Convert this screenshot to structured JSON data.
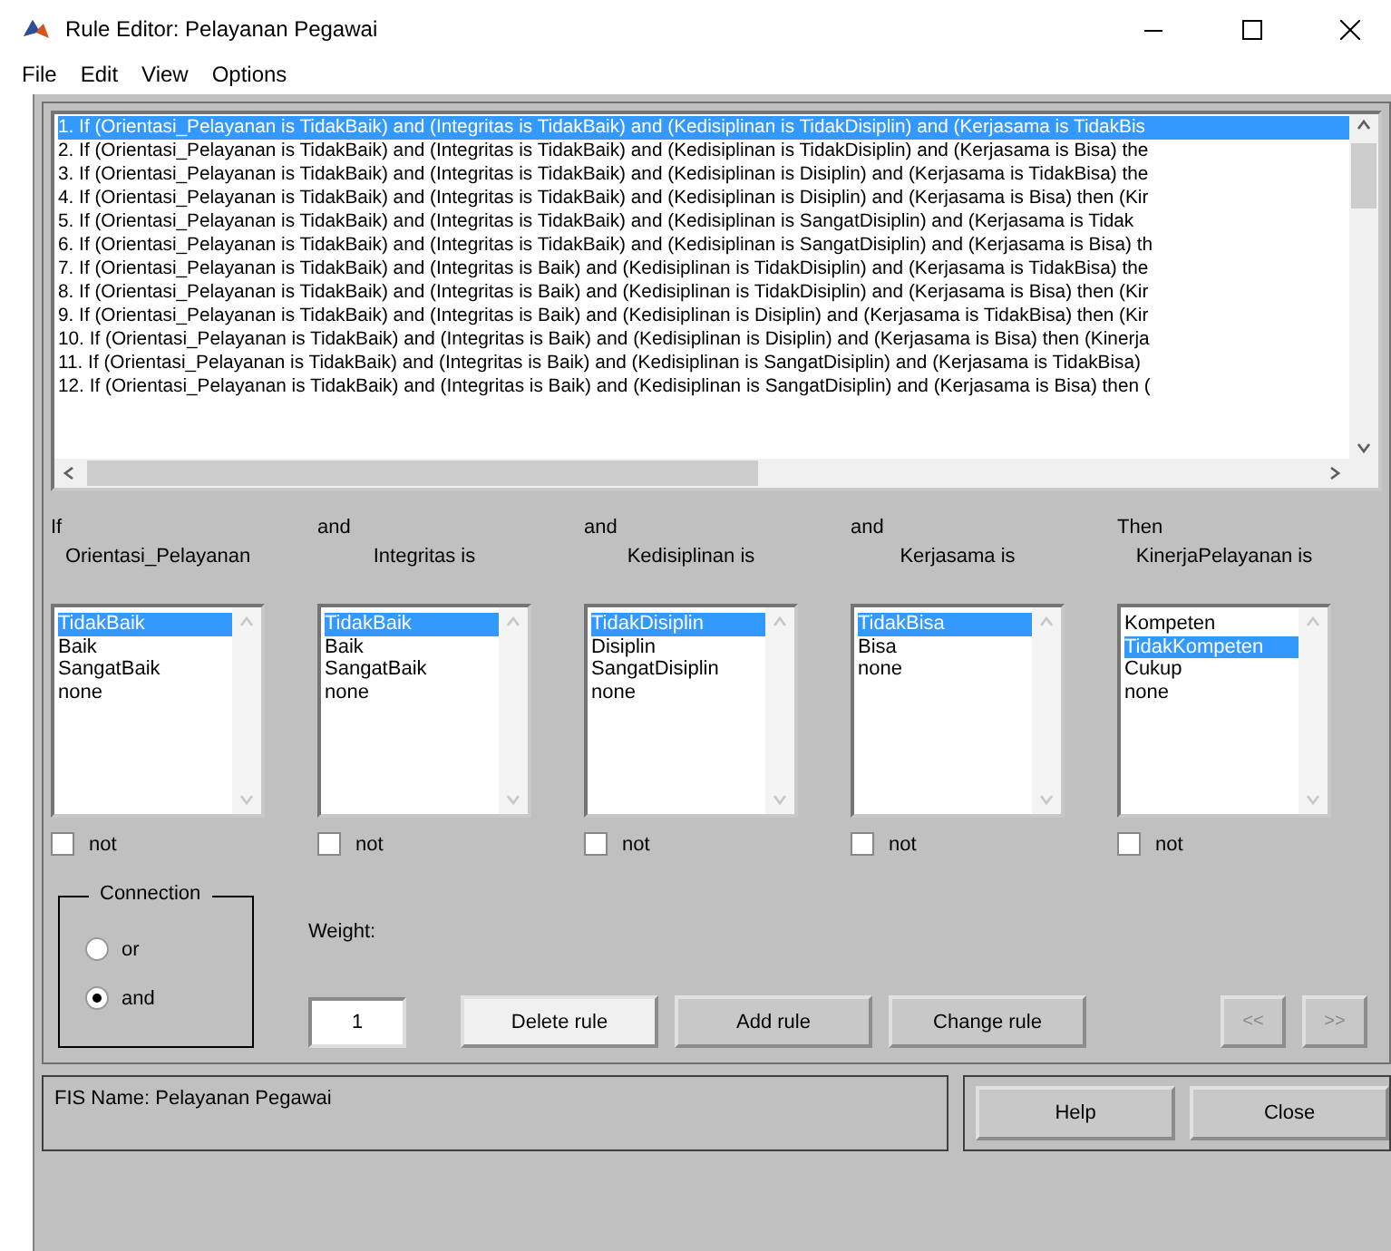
{
  "window": {
    "title": "Rule Editor: Pelayanan Pegawai"
  },
  "menu": [
    "File",
    "Edit",
    "View",
    "Options"
  ],
  "rules": [
    {
      "text": "1. If (Orientasi_Pelayanan is TidakBaik) and (Integritas is TidakBaik) and (Kedisiplinan is TidakDisiplin) and (Kerjasama is TidakBis",
      "selected": true
    },
    {
      "text": "2. If (Orientasi_Pelayanan is TidakBaik) and (Integritas is TidakBaik) and (Kedisiplinan is TidakDisiplin) and (Kerjasama is Bisa) the",
      "selected": false
    },
    {
      "text": "3. If (Orientasi_Pelayanan is TidakBaik) and (Integritas is TidakBaik) and (Kedisiplinan is Disiplin) and (Kerjasama is TidakBisa) the",
      "selected": false
    },
    {
      "text": "4. If (Orientasi_Pelayanan is TidakBaik) and (Integritas is TidakBaik) and (Kedisiplinan is Disiplin) and (Kerjasama is Bisa) then (Kir",
      "selected": false
    },
    {
      "text": "5. If (Orientasi_Pelayanan is TidakBaik) and (Integritas is TidakBaik) and (Kedisiplinan is SangatDisiplin) and (Kerjasama is Tidak",
      "selected": false
    },
    {
      "text": "6. If (Orientasi_Pelayanan is TidakBaik) and (Integritas is TidakBaik) and (Kedisiplinan is SangatDisiplin) and (Kerjasama is Bisa) th",
      "selected": false
    },
    {
      "text": "7. If (Orientasi_Pelayanan is TidakBaik) and (Integritas is Baik) and (Kedisiplinan is TidakDisiplin) and (Kerjasama is TidakBisa) the",
      "selected": false
    },
    {
      "text": "8. If (Orientasi_Pelayanan is TidakBaik) and (Integritas is Baik) and (Kedisiplinan is TidakDisiplin) and (Kerjasama is Bisa) then (Kir",
      "selected": false
    },
    {
      "text": "9. If (Orientasi_Pelayanan is TidakBaik) and (Integritas is Baik) and (Kedisiplinan is Disiplin) and (Kerjasama is TidakBisa) then (Kir",
      "selected": false
    },
    {
      "text": "10. If (Orientasi_Pelayanan is TidakBaik) and (Integritas is Baik) and (Kedisiplinan is Disiplin) and (Kerjasama is Bisa) then (Kinerja",
      "selected": false
    },
    {
      "text": "11. If (Orientasi_Pelayanan is TidakBaik) and (Integritas is Baik) and (Kedisiplinan is SangatDisiplin) and (Kerjasama is TidakBisa)",
      "selected": false
    },
    {
      "text": "12. If (Orientasi_Pelayanan is TidakBaik) and (Integritas is Baik) and (Kedisiplinan is SangatDisiplin) and (Kerjasama is Bisa) then (",
      "selected": false
    }
  ],
  "columns": [
    {
      "connector": "If",
      "variable": "Orientasi_Pelayanan",
      "items": [
        {
          "label": "TidakBaik",
          "selected": true
        },
        {
          "label": "Baik",
          "selected": false
        },
        {
          "label": "SangatBaik",
          "selected": false
        },
        {
          "label": "none",
          "selected": false
        }
      ],
      "not": {
        "label": "not",
        "checked": false
      }
    },
    {
      "connector": "and",
      "variable": "Integritas is",
      "items": [
        {
          "label": "TidakBaik",
          "selected": true
        },
        {
          "label": "Baik",
          "selected": false
        },
        {
          "label": "SangatBaik",
          "selected": false
        },
        {
          "label": "none",
          "selected": false
        }
      ],
      "not": {
        "label": "not",
        "checked": false
      }
    },
    {
      "connector": "and",
      "variable": "Kedisiplinan is",
      "items": [
        {
          "label": "TidakDisiplin",
          "selected": true
        },
        {
          "label": "Disiplin",
          "selected": false
        },
        {
          "label": "SangatDisiplin",
          "selected": false
        },
        {
          "label": "none",
          "selected": false
        }
      ],
      "not": {
        "label": "not",
        "checked": false
      }
    },
    {
      "connector": "and",
      "variable": "Kerjasama is",
      "items": [
        {
          "label": "TidakBisa",
          "selected": true
        },
        {
          "label": "Bisa",
          "selected": false
        },
        {
          "label": "none",
          "selected": false
        }
      ],
      "not": {
        "label": "not",
        "checked": false
      }
    },
    {
      "connector": "Then",
      "variable": "KinerjaPelayanan is",
      "items": [
        {
          "label": "Kompeten",
          "selected": false
        },
        {
          "label": "TidakKompeten",
          "selected": true
        },
        {
          "label": "Cukup",
          "selected": false
        },
        {
          "label": "none",
          "selected": false
        }
      ],
      "not": {
        "label": "not",
        "checked": false
      }
    }
  ],
  "connection": {
    "title": "Connection",
    "options": [
      {
        "label": "or",
        "selected": false
      },
      {
        "label": "and",
        "selected": true
      }
    ]
  },
  "weight": {
    "label": "Weight:",
    "value": "1"
  },
  "buttons": [
    {
      "label": "Delete rule",
      "pressed": true
    },
    {
      "label": "Add rule",
      "pressed": false
    },
    {
      "label": "Change rule",
      "pressed": false
    }
  ],
  "nav_buttons": [
    {
      "label": "<<",
      "disabled": true
    },
    {
      "label": ">>",
      "disabled": true
    }
  ],
  "status": "FIS Name: Pelayanan Pegawai",
  "footer_buttons": [
    "Help",
    "Close"
  ]
}
